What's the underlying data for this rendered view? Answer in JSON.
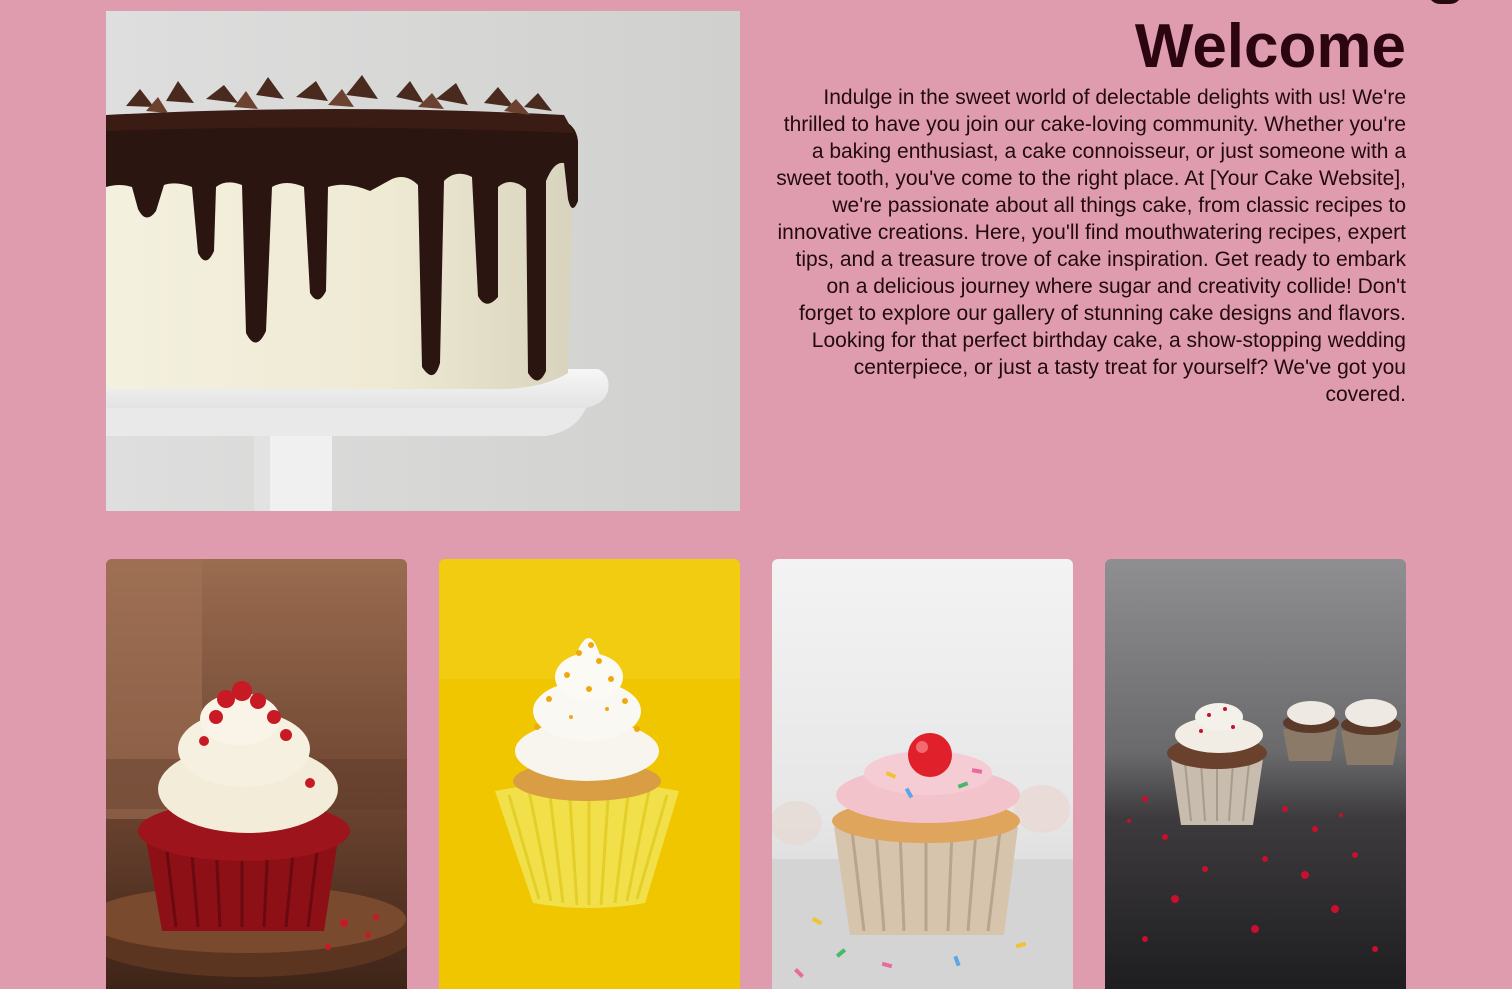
{
  "welcome": {
    "title": "Welcome",
    "body": "Indulge in the sweet world of delectable delights with us! We're thrilled to have you join our cake-loving community. Whether you're a baking enthusiast, a cake connoisseur, or just someone with a sweet tooth, you've come to the right place. At [Your Cake Website], we're passionate about all things cake, from classic recipes to innovative creations. Here, you'll find mouthwatering recipes, expert tips, and a treasure trove of cake inspiration. Get ready to embark on a delicious journey where sugar and creativity collide! Don't forget to explore our gallery of stunning cake designs and flavors. Looking for that perfect birthday cake, a show-stopping wedding centerpiece, or just a tasty treat for yourself? We've got you covered."
  },
  "colors": {
    "page_background": "#df9caf",
    "title_text": "#2b0611",
    "body_text": "#220a10"
  },
  "images": {
    "hero": "white cake with dripping chocolate ganache on a cake stand",
    "gallery": [
      "red velvet cupcake with cream cheese frosting",
      "cupcake with white frosting and yellow sprinkles on yellow background",
      "vanilla cupcake with pink frosting and a cherry",
      "chocolate cupcakes with red crumbs on dark surface"
    ]
  }
}
